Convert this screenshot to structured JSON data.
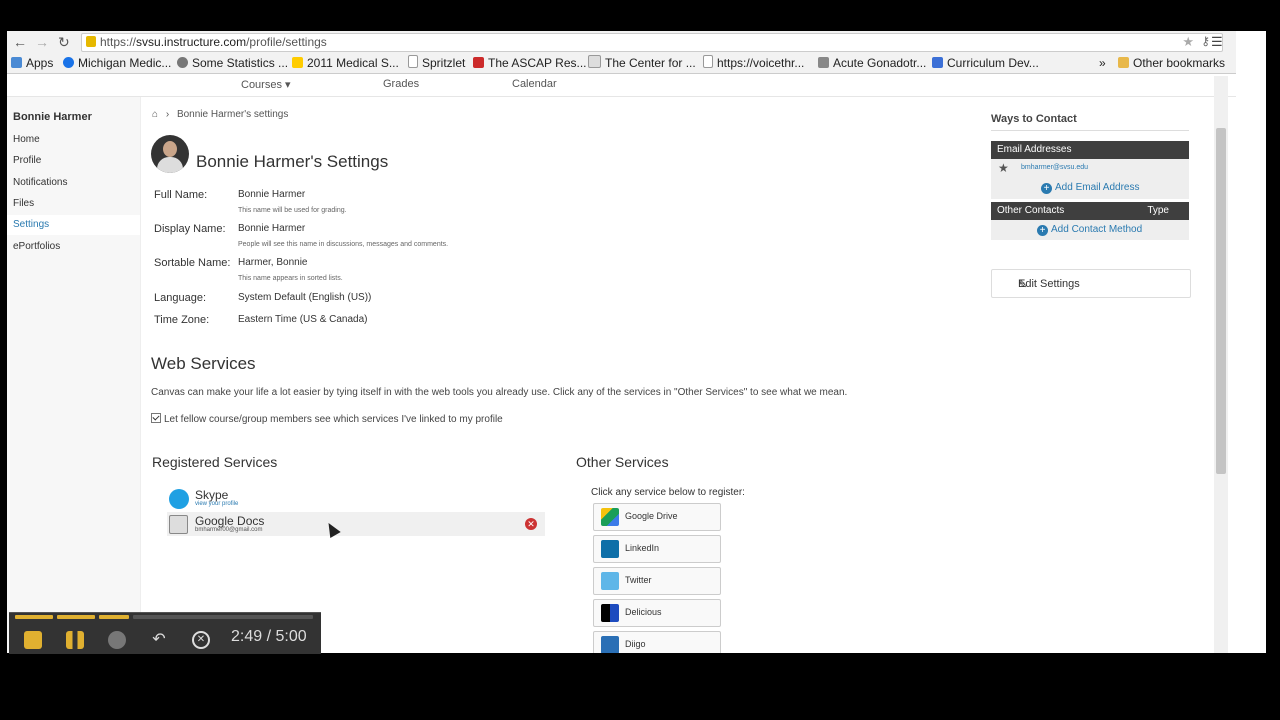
{
  "browser": {
    "url_scheme": "https://",
    "url_host": "svsu.instructure.com",
    "url_path": "/profile/settings",
    "bookmarks": [
      {
        "label": "Apps",
        "color": "#4a8ad4"
      },
      {
        "label": "Michigan Medic...",
        "color": "#1a73e8"
      },
      {
        "label": "Some Statistics ...",
        "color": "#777777"
      },
      {
        "label": "2011 Medical S...",
        "color": "#ffcc00"
      },
      {
        "label": "Spritzlet",
        "color": "#dddddd"
      },
      {
        "label": "The ASCAP Res...",
        "color": "#cc2a2a"
      },
      {
        "label": "The Center for ...",
        "color": "#dddddd"
      },
      {
        "label": "https://voicethr...",
        "color": "#dddddd"
      },
      {
        "label": "Acute Gonadotr...",
        "color": "#888888"
      },
      {
        "label": "Curriculum Dev...",
        "color": "#3b6fd6"
      },
      {
        "label": "Other bookmarks",
        "color": "#e8b84a"
      }
    ],
    "more": "»"
  },
  "topnav": {
    "courses": "Courses ▾",
    "grades": "Grades",
    "calendar": "Calendar"
  },
  "leftnav": {
    "user": "Bonnie Harmer",
    "items": [
      "Home",
      "Profile",
      "Notifications",
      "Files",
      "Settings",
      "ePortfolios"
    ],
    "active": "Settings"
  },
  "breadcrumb": {
    "home": "⌂",
    "sep": "›",
    "current": "Bonnie Harmer's settings"
  },
  "profile": {
    "title": "Bonnie Harmer's Settings",
    "fields": [
      {
        "label": "Full Name:",
        "value": "Bonnie Harmer",
        "hint": "This name will be used for grading."
      },
      {
        "label": "Display Name:",
        "value": "Bonnie Harmer",
        "hint": "People will see this name in discussions, messages and comments."
      },
      {
        "label": "Sortable Name:",
        "value": "Harmer, Bonnie",
        "hint": "This name appears in sorted lists."
      },
      {
        "label": "Language:",
        "value": "System Default (English (US))",
        "hint": ""
      },
      {
        "label": "Time Zone:",
        "value": "Eastern Time (US & Canada)",
        "hint": ""
      }
    ]
  },
  "web_services": {
    "heading": "Web Services",
    "description": "Canvas can make your life a lot easier by tying itself in with the web tools you already use. Click any of the services in \"Other Services\" to see what we mean.",
    "checkbox_label": "Let fellow course/group members see which services I've linked to my profile",
    "registered_heading": "Registered Services",
    "registered": [
      {
        "name": "Skype",
        "sub": "view your profile",
        "color": "#1fa0e3"
      },
      {
        "name": "Google Docs",
        "sub": "bmharmer00@gmail.com",
        "color": "#bbbbbb"
      }
    ],
    "delete_icon": "✕",
    "other_heading": "Other Services",
    "other_hint": "Click any service below to register:",
    "other": [
      {
        "name": "Google Drive",
        "color": "#1a9e58"
      },
      {
        "name": "LinkedIn",
        "color": "#0e6fa8"
      },
      {
        "name": "Twitter",
        "color": "#5eb6e8"
      },
      {
        "name": "Delicious",
        "color": "#1d4bbf"
      },
      {
        "name": "Diigo",
        "color": "#2a6fb5"
      }
    ]
  },
  "contact": {
    "heading": "Ways to Contact",
    "email_header": "Email Addresses",
    "email": "bmharmer@svsu.edu",
    "add_email": "Add Email Address",
    "other_header": "Other Contacts",
    "type_header": "Type",
    "add_contact": "Add Contact Method",
    "edit_settings": "Edit Settings"
  },
  "recorder": {
    "time": "2:49 / 5:00",
    "accent": "#e0b030"
  }
}
